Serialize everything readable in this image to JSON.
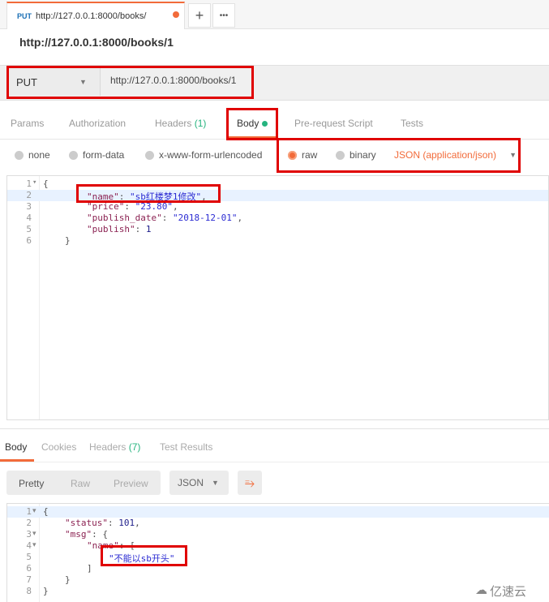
{
  "tab": {
    "method": "PUT",
    "url": "http://127.0.0.1:8000/books/",
    "new_tab": "+",
    "more": "•••"
  },
  "title": "http://127.0.0.1:8000/books/1",
  "request": {
    "method": "PUT",
    "url": "http://127.0.0.1:8000/books/1"
  },
  "req_tabs": {
    "params": "Params",
    "authorization": "Authorization",
    "headers": "Headers",
    "headers_count": "(1)",
    "body": "Body",
    "prerequest": "Pre-request Script",
    "tests": "Tests"
  },
  "body_types": {
    "none": "none",
    "form_data": "form-data",
    "urlencoded": "x-www-form-urlencoded",
    "raw": "raw",
    "binary": "binary",
    "content_type": "JSON (application/json)",
    "selected": "raw"
  },
  "request_body": [
    {
      "n": "1",
      "fold": true,
      "parts": [
        [
          "p",
          "{"
        ]
      ]
    },
    {
      "n": "2",
      "parts": [
        [
          "k",
          "\"name\""
        ],
        [
          "p",
          ": "
        ],
        [
          "s",
          "\"sb红楼梦1修改\""
        ],
        [
          "p",
          ","
        ]
      ]
    },
    {
      "n": "3",
      "parts": [
        [
          "k",
          "\"price\""
        ],
        [
          "p",
          ": "
        ],
        [
          "s",
          "\"23.80\""
        ],
        [
          "p",
          ","
        ]
      ]
    },
    {
      "n": "4",
      "parts": [
        [
          "k",
          "\"publish_date\""
        ],
        [
          "p",
          ": "
        ],
        [
          "s",
          "\"2018-12-01\""
        ],
        [
          "p",
          ","
        ]
      ]
    },
    {
      "n": "5",
      "parts": [
        [
          "k",
          "\"publish\""
        ],
        [
          "p",
          ": "
        ],
        [
          "n",
          "1"
        ]
      ]
    },
    {
      "n": "6",
      "parts": [
        [
          "p",
          "}"
        ]
      ]
    }
  ],
  "resp_tabs": {
    "body": "Body",
    "cookies": "Cookies",
    "headers": "Headers",
    "headers_count": "(7)",
    "test_results": "Test Results"
  },
  "resp_toolbar": {
    "pretty": "Pretty",
    "raw": "Raw",
    "preview": "Preview",
    "format": "JSON"
  },
  "response_body": [
    {
      "n": "1",
      "fold": true,
      "parts": [
        [
          "p",
          "{"
        ]
      ]
    },
    {
      "n": "2",
      "parts": [
        [
          "k",
          "\"status\""
        ],
        [
          "p",
          ": "
        ],
        [
          "n",
          "101"
        ],
        [
          "p",
          ","
        ]
      ]
    },
    {
      "n": "3",
      "fold": true,
      "parts": [
        [
          "k",
          "\"msg\""
        ],
        [
          "p",
          ": {"
        ]
      ]
    },
    {
      "n": "4",
      "fold": true,
      "parts": [
        [
          "k",
          "\"name\""
        ],
        [
          "p",
          ": ["
        ]
      ]
    },
    {
      "n": "5",
      "parts": [
        [
          "s",
          "\"不能以sb开头\""
        ]
      ]
    },
    {
      "n": "6",
      "parts": [
        [
          "p",
          "]"
        ]
      ]
    },
    {
      "n": "7",
      "parts": [
        [
          "p",
          "}"
        ]
      ]
    },
    {
      "n": "8",
      "parts": [
        [
          "p",
          "}"
        ]
      ]
    }
  ],
  "colors": {
    "accent": "#f26b3a",
    "green": "#26b47f",
    "highlight": "#e00000"
  },
  "watermark": "亿速云"
}
